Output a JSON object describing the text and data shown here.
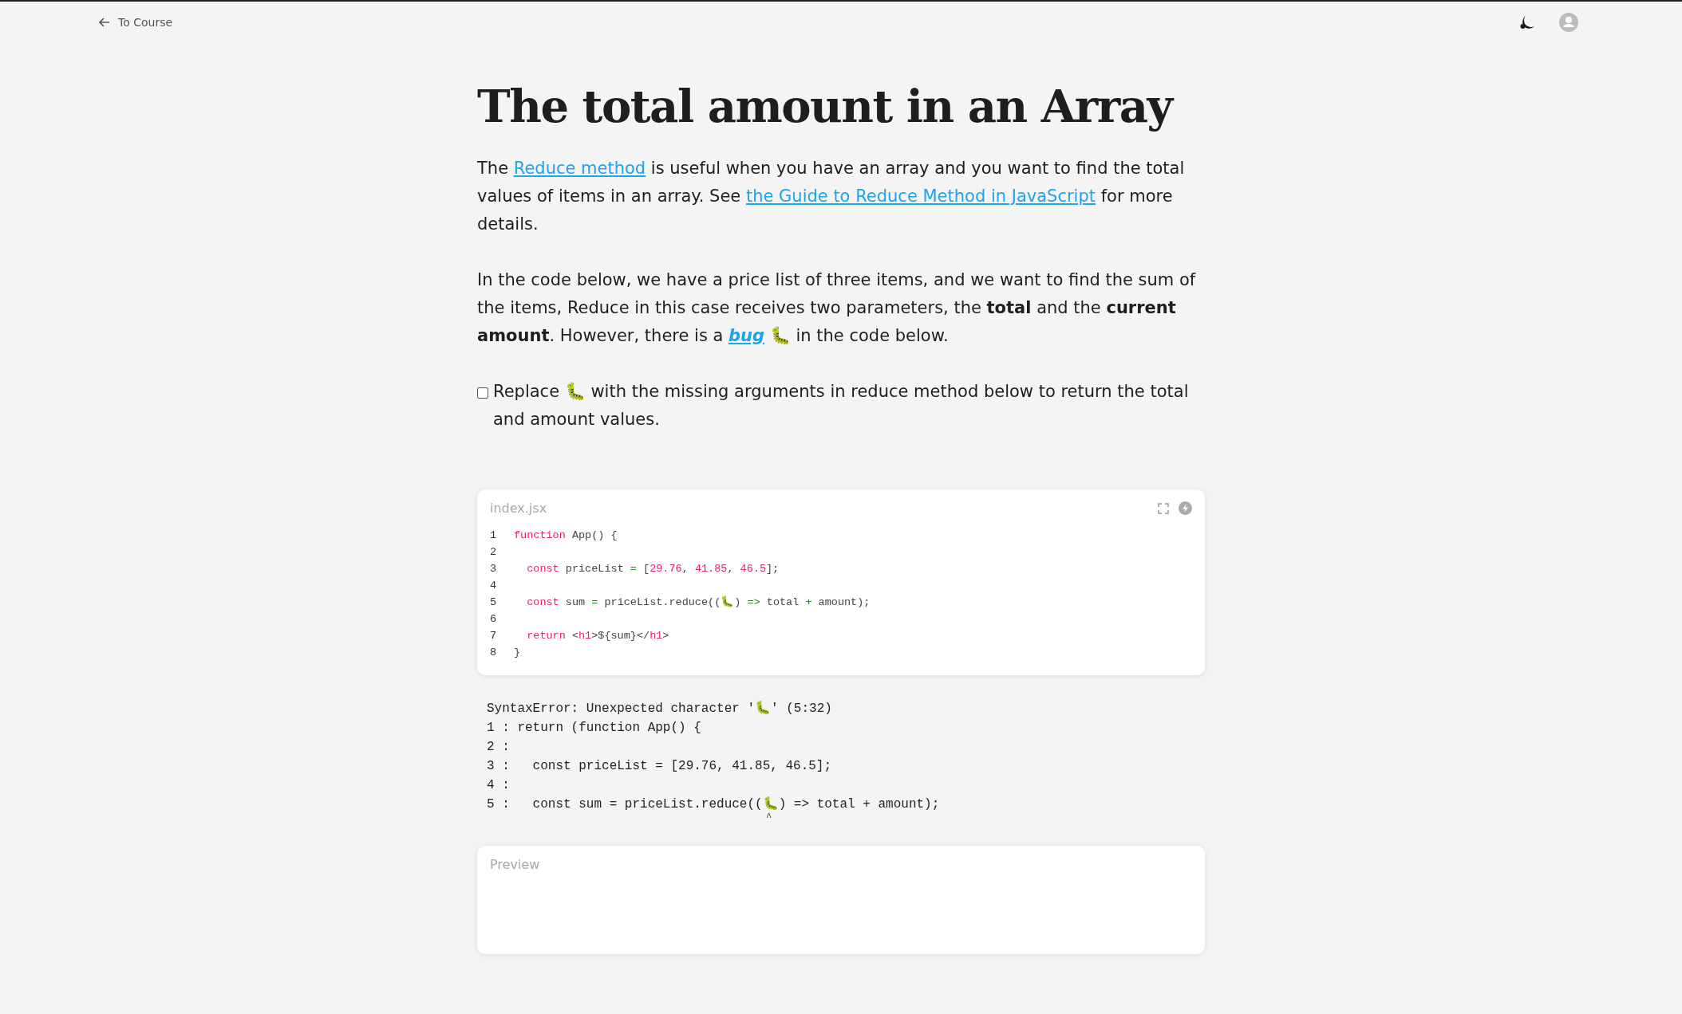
{
  "nav": {
    "back_label": "To Course"
  },
  "title": "The total amount in an Array",
  "paragraphs": [
    {
      "segments": [
        {
          "kind": "text",
          "text": "The "
        },
        {
          "kind": "link",
          "text": "Reduce method"
        },
        {
          "kind": "text",
          "text": " is useful when you have an array and you want to find the total values of items in an array.  See "
        },
        {
          "kind": "link",
          "text": "the Guide to Reduce Method in JavaScript"
        },
        {
          "kind": "text",
          "text": " for more details."
        }
      ]
    },
    {
      "segments": [
        {
          "kind": "text",
          "text": "In the code below, we have a price list of three items, and we want to find the sum of the items, Reduce in this case receives two parameters, the **total** and the **current amount**. However, there is a "
        },
        {
          "kind": "italic-link",
          "text": "bug"
        },
        {
          "kind": "text",
          "text": " 🐛 in the code below."
        }
      ]
    }
  ],
  "task": {
    "checked": false,
    "text": "Replace 🐛 with the missing arguments in reduce method below to return the total and amount values."
  },
  "editor": {
    "filename": "index.jsx",
    "lines": [
      {
        "number": "1",
        "tokens": [
          {
            "kind": "keyword",
            "text": "function"
          },
          {
            "kind": "plain",
            "text": " App() {"
          }
        ]
      },
      {
        "number": "2"
      },
      {
        "number": "3",
        "tokens": [
          {
            "kind": "keyword",
            "text": "  const"
          },
          {
            "kind": "plain",
            "text": " priceList "
          },
          {
            "kind": "operator",
            "text": "="
          },
          {
            "kind": "plain",
            "text": " ["
          },
          {
            "kind": "number",
            "text": "29.76"
          },
          {
            "kind": "plain",
            "text": ", "
          },
          {
            "kind": "number",
            "text": "41.85"
          },
          {
            "kind": "plain",
            "text": ", "
          },
          {
            "kind": "number",
            "text": "46.5"
          },
          {
            "kind": "plain",
            "text": "];"
          }
        ]
      },
      {
        "number": "4"
      },
      {
        "number": "5",
        "tokens": [
          {
            "kind": "keyword",
            "text": "  const"
          },
          {
            "kind": "plain",
            "text": " sum "
          },
          {
            "kind": "operator",
            "text": "="
          },
          {
            "kind": "plain",
            "text": " priceList.reduce((🐛) "
          },
          {
            "kind": "operator",
            "text": "=>"
          },
          {
            "kind": "plain",
            "text": " total "
          },
          {
            "kind": "operator",
            "text": "+"
          },
          {
            "kind": "plain",
            "text": " amount);"
          }
        ]
      },
      {
        "number": "6"
      },
      {
        "number": "7",
        "tokens": [
          {
            "kind": "keyword",
            "text": "  return"
          },
          {
            "kind": "plain",
            "text": " <"
          },
          {
            "kind": "keyword",
            "text": "h1"
          },
          {
            "kind": "plain",
            "text": ">${sum}</"
          },
          {
            "kind": "keyword",
            "text": "h1"
          },
          {
            "kind": "plain",
            "text": ">"
          }
        ]
      },
      {
        "number": "8",
        "tokens": [
          {
            "kind": "plain",
            "text": "}"
          }
        ]
      }
    ]
  },
  "error": {
    "lines": [
      "SyntaxError: Unexpected character '🐛' (5:32)",
      "1 : return (function App() {",
      "2 :",
      "3 :   const priceList = [29.76, 41.85, 46.5];",
      "4 :",
      "5 :   const sum = priceList.reduce((🐛) => total + amount);"
    ],
    "caret": "^"
  },
  "preview": {
    "label": "Preview"
  }
}
